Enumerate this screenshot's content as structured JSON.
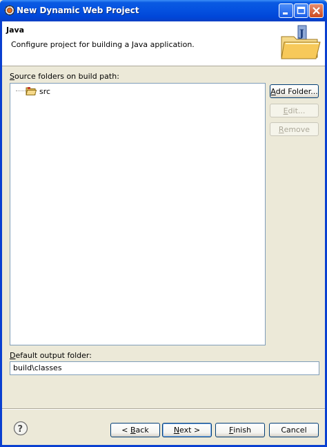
{
  "window": {
    "title": "New Dynamic Web Project"
  },
  "banner": {
    "title": "Java",
    "description": "Configure project for building a Java application."
  },
  "source_section": {
    "label_mnemonic": "S",
    "label_rest": "ource folders on build path:",
    "items": [
      {
        "label": "src",
        "icon": "source-folder-icon"
      }
    ]
  },
  "side_buttons": {
    "add_folder": {
      "mnemonic": "A",
      "rest": "dd Folder..."
    },
    "edit": {
      "mnemonic": "E",
      "rest": "dit..."
    },
    "remove": {
      "mnemonic": "R",
      "rest": "emove"
    }
  },
  "output": {
    "label_mnemonic": "D",
    "label_rest": "efault output folder:",
    "value": "build\\classes"
  },
  "footer": {
    "back": {
      "prefix": "< ",
      "mnemonic": "B",
      "rest": "ack"
    },
    "next": {
      "mnemonic": "N",
      "rest": "ext >"
    },
    "finish": {
      "mnemonic": "F",
      "rest": "inish"
    },
    "cancel": "Cancel"
  }
}
